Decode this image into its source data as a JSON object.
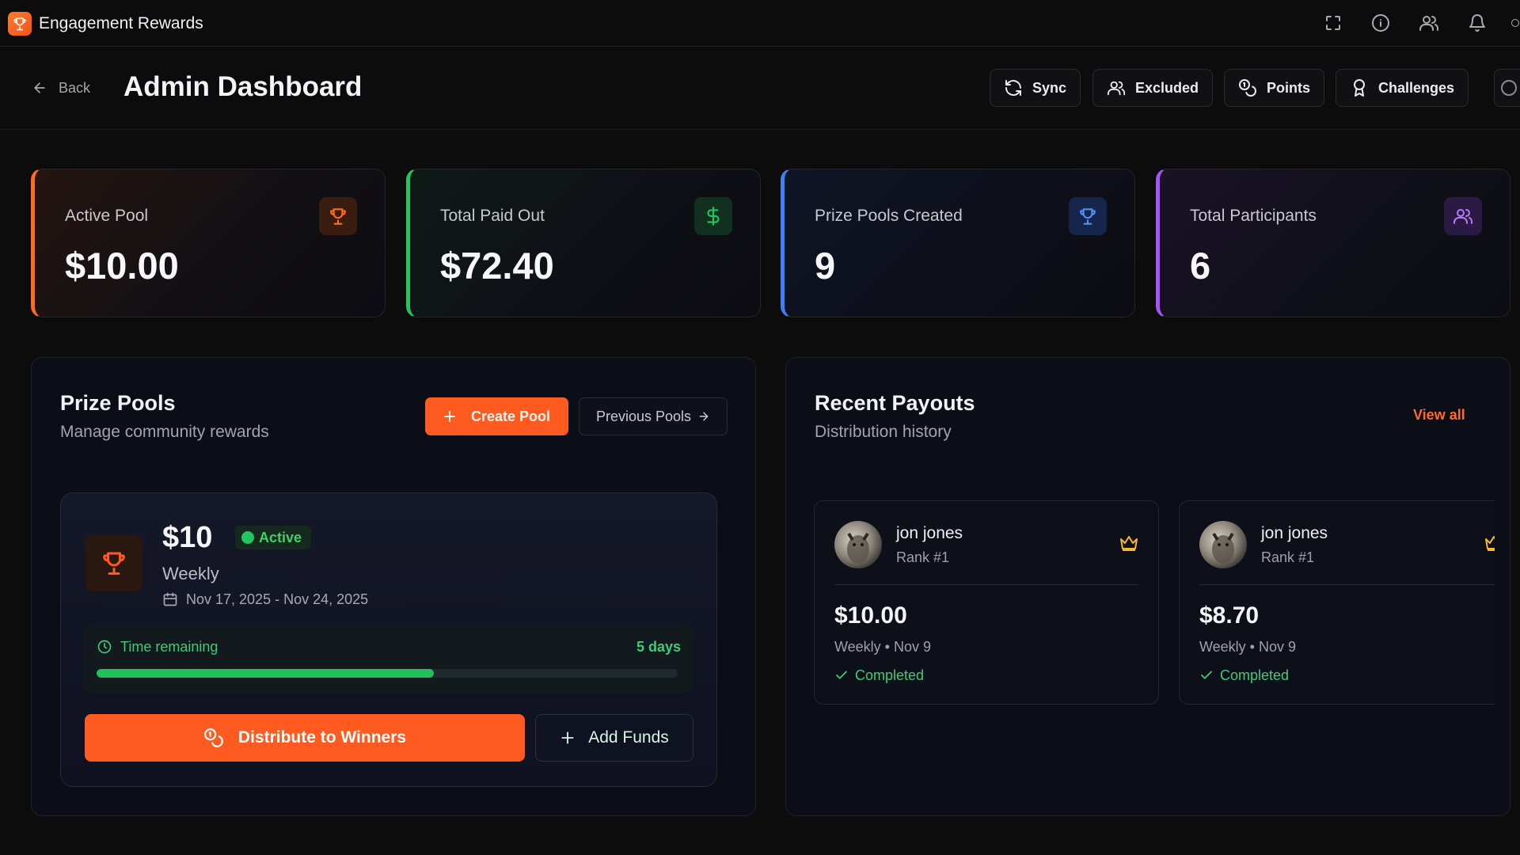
{
  "app": {
    "title": "Engagement Rewards",
    "icons": [
      "fullscreen-icon",
      "info-icon",
      "users-icon",
      "bell-icon"
    ]
  },
  "header": {
    "back_label": "Back",
    "title": "Admin Dashboard",
    "buttons": [
      {
        "label": "Sync",
        "icon": "refresh-icon"
      },
      {
        "label": "Excluded",
        "icon": "users-icon"
      },
      {
        "label": "Points",
        "icon": "coins-icon"
      },
      {
        "label": "Challenges",
        "icon": "award-icon"
      }
    ]
  },
  "stats": [
    {
      "label": "Active Pool",
      "value": "$10.00",
      "icon": "trophy-icon",
      "accent": "#ff6a1f"
    },
    {
      "label": "Total Paid Out",
      "value": "$72.40",
      "icon": "dollar-icon",
      "accent": "#22c55e"
    },
    {
      "label": "Prize Pools Created",
      "value": "9",
      "icon": "trophy-icon",
      "accent": "#3b82f6"
    },
    {
      "label": "Total Participants",
      "value": "6",
      "icon": "users-icon",
      "accent": "#a855f7"
    }
  ],
  "prize_pools": {
    "title": "Prize Pools",
    "subtitle": "Manage community rewards",
    "create_label": "Create Pool",
    "previous_label": "Previous Pools",
    "pool": {
      "amount": "$10",
      "status": "Active",
      "period": "Weekly",
      "dates": "Nov 17, 2025 - Nov 24, 2025",
      "time_label": "Time remaining",
      "time_value": "5 days",
      "progress_fraction": 0.58,
      "distribute_label": "Distribute to Winners",
      "add_funds_label": "Add Funds"
    }
  },
  "recent_payouts": {
    "title": "Recent Payouts",
    "subtitle": "Distribution history",
    "view_all_label": "View all",
    "items": [
      {
        "name": "jon jones",
        "rank": "Rank #1",
        "amount": "$10.00",
        "meta": "Weekly • Nov 9",
        "status": "Completed"
      },
      {
        "name": "jon jones",
        "rank": "Rank #1",
        "amount": "$8.70",
        "meta": "Weekly • Nov 9",
        "status": "Completed"
      }
    ]
  },
  "colors": {
    "accent": "#ff5a1f",
    "success": "#22c55e",
    "background": "#0c0c0c"
  }
}
